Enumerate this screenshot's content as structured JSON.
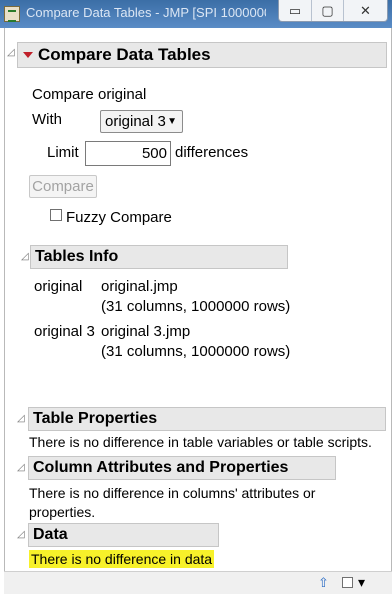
{
  "window": {
    "title": "Compare Data Tables - JMP [SPI 1000000]",
    "controls": {
      "minimize": "▭",
      "restore": "▢",
      "close": "✕"
    }
  },
  "compare_panel": {
    "title": "Compare Data Tables",
    "compare_label": "Compare",
    "compare_value": "original",
    "with_label": "With",
    "with_selected": "original 3",
    "limit_label": "Limit",
    "limit_value": "500",
    "limit_suffix": "differences",
    "compare_button": "Compare",
    "fuzzy_label": "Fuzzy Compare",
    "fuzzy_checked": false
  },
  "tables_info": {
    "title": "Tables Info",
    "rows": [
      {
        "name": "original",
        "file": "original.jmp",
        "detail": "(31 columns, 1000000 rows)"
      },
      {
        "name": "original 3",
        "file": "original 3.jmp",
        "detail": "(31 columns, 1000000 rows)"
      }
    ]
  },
  "table_properties": {
    "title": "Table Properties",
    "message": "There is no difference in table variables or table scripts."
  },
  "column_attributes": {
    "title": "Column Attributes and Properties",
    "message_line1": "There is no difference in columns' attributes or",
    "message_line2": "properties."
  },
  "data_section": {
    "title": "Data",
    "message": "There is no difference in data",
    "highlight_color": "#f7f12a"
  },
  "statusbar": {
    "home_icon": "⇧",
    "menu_icon": "▾"
  }
}
